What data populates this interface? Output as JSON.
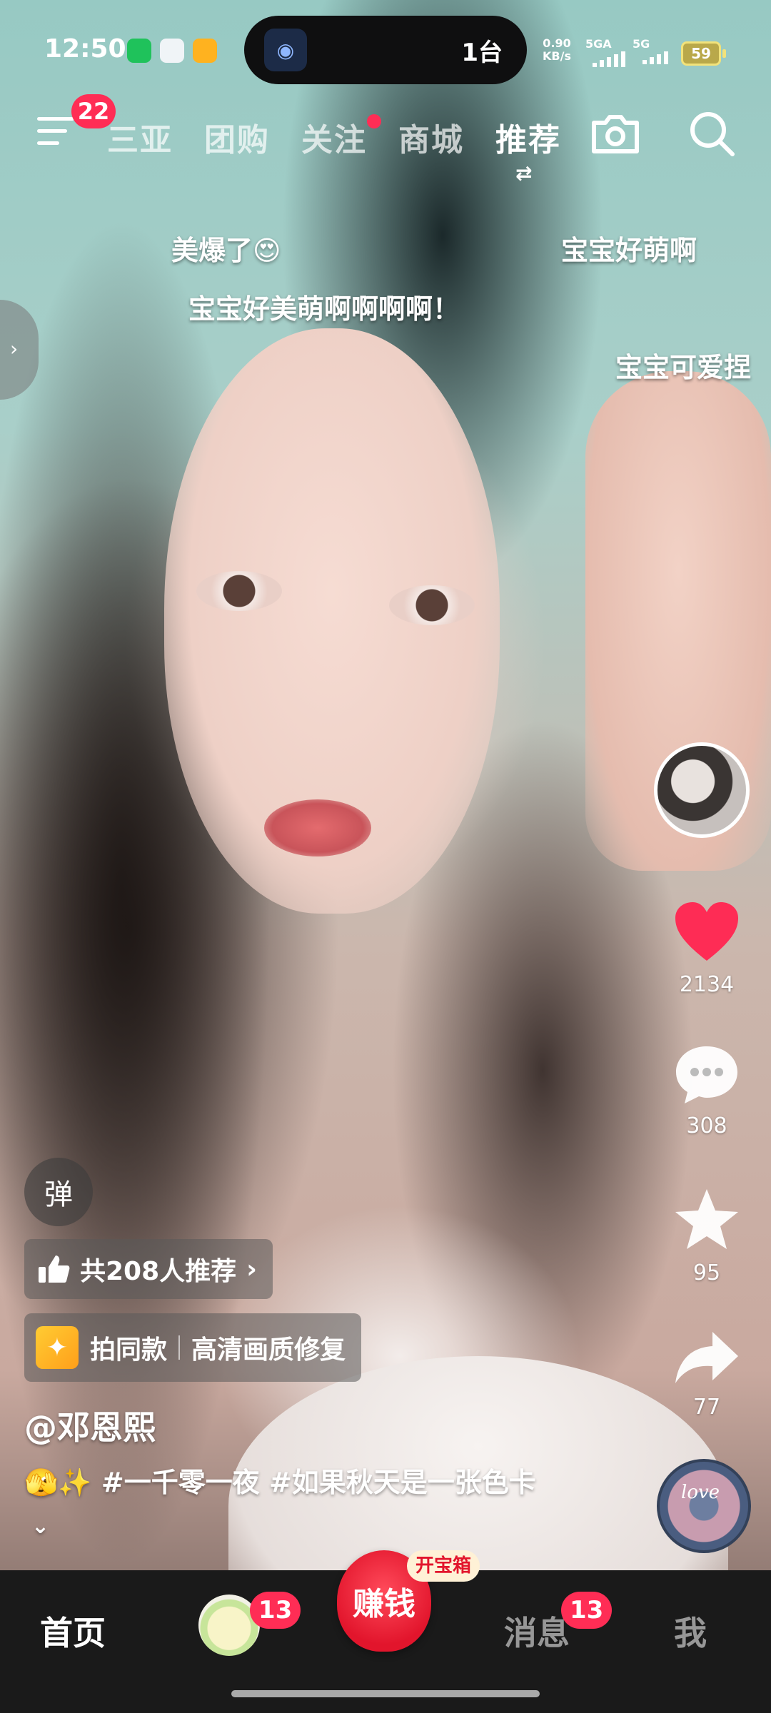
{
  "status_bar": {
    "time": "12:50",
    "island_count": "1台",
    "net_speed": "0.90",
    "net_unit": "KB/s",
    "sim1": "5GA",
    "sim2": "5G",
    "battery": "59"
  },
  "top_nav": {
    "menu_badge": "22",
    "tabs": [
      {
        "label": "三亚"
      },
      {
        "label": "团购"
      },
      {
        "label": "关注"
      },
      {
        "label": "商城"
      },
      {
        "label": "推荐"
      }
    ],
    "active_tab": "推荐",
    "swap_icon": "⇄"
  },
  "danmaku": [
    {
      "text": "美爆了😍"
    },
    {
      "text": "宝宝好萌啊"
    },
    {
      "text": "宝宝好美萌啊啊啊啊！"
    },
    {
      "text": "宝宝可爱捏"
    }
  ],
  "side_handle": "›",
  "actions": {
    "like_count": "2134",
    "comment_count": "308",
    "favorite_count": "95",
    "share_count": "77"
  },
  "music_disc_text": "love",
  "info": {
    "danmu_toggle": "弹",
    "recommend_text": "共208人推荐",
    "recommend_arrow": "›",
    "same_style": "拍同款",
    "hd_fix": "高清画质修复",
    "author": "@邓恩熙",
    "desc_emoji": "🫣✨",
    "desc": "#一千零一夜 #如果秋天是一张色卡",
    "more": "⌄"
  },
  "bottom_nav": {
    "home": "首页",
    "friends_badge": "13",
    "earn": "赚钱",
    "treasure": "开宝箱",
    "messages": "消息",
    "messages_badge": "13",
    "me": "我"
  },
  "colors": {
    "accent_red": "#ff2d55",
    "earn_red": "#e2152c"
  }
}
